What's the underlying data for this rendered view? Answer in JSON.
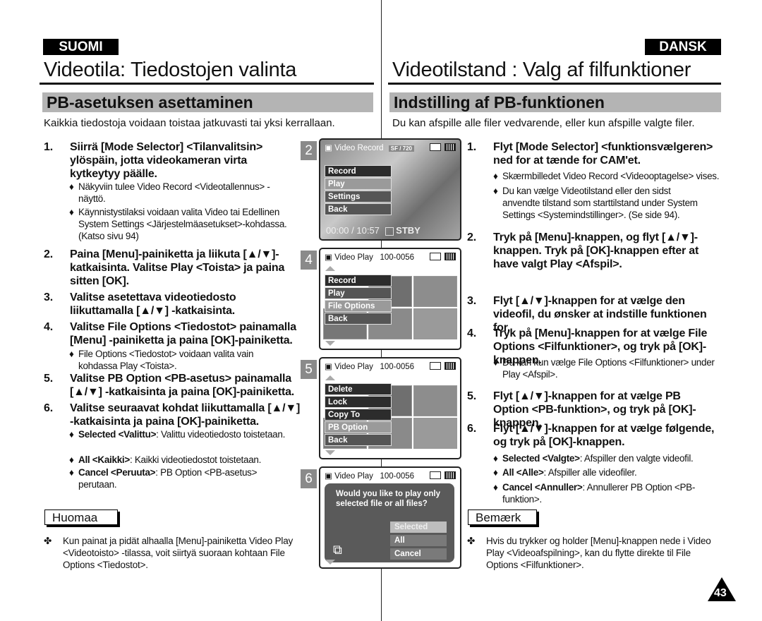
{
  "left": {
    "lang": "SUOMI",
    "title": "Videotila: Tiedostojen valinta",
    "section": "PB-asetuksen asettaminen",
    "intro": "Kaikkia tiedostoja voidaan toistaa jatkuvasti tai yksi kerrallaan.",
    "steps": [
      {
        "num": "1.",
        "text": "Siirrä [Mode Selector] <Tilanvalitsin> ylöspäin, jotta videokameran virta kytkeytyy päälle."
      },
      {
        "num": "2.",
        "text": "Paina [Menu]-painiketta ja liikuta [▲/▼]-katkaisinta. Valitse Play <Toista> ja paina sitten [OK]."
      },
      {
        "num": "3.",
        "text": "Valitse asetettava videotiedosto liikuttamalla [▲/▼] -katkaisinta."
      },
      {
        "num": "4.",
        "text": "Valitse File Options <Tiedostot> painamalla [Menu] -painiketta ja paina [OK]-painiketta."
      },
      {
        "num": "5.",
        "text": "Valitse PB Option <PB-asetus> painamalla [▲/▼] -katkaisinta ja paina [OK]-painiketta."
      },
      {
        "num": "6.",
        "text": "Valitse seuraavat kohdat liikuttamalla [▲/▼] -katkaisinta ja paina [OK]-painiketta."
      }
    ],
    "bullets": {
      "s1a": "Näkyviin tulee Video Record <Videotallennus> -näyttö.",
      "s1b": "Käynnistystilaksi voidaan valita Video tai Edellinen System Settings <Järjestelmäasetukset>-kohdassa. (Katso sivu 94)",
      "s4a": "File Options <Tiedostot> voidaan valita vain kohdassa Play <Toista>.",
      "s6a_label": "Selected <Valittu>",
      "s6a_text": ": Valittu videotiedosto toistetaan.",
      "s6b_label": "All <Kaikki>",
      "s6b_text": ": Kaikki videotiedostot toistetaan.",
      "s6c_label": "Cancel <Peruuta>",
      "s6c_text": ": PB Option <PB-asetus> perutaan."
    },
    "note_title": "Huomaa",
    "note": "Kun painat ja pidät alhaalla [Menu]-painiketta Video Play <Videotoisto> -tilassa, voit siirtyä suoraan kohtaan File Options <Tiedostot>."
  },
  "right": {
    "lang": "DANSK",
    "title": "Videotilstand : Valg af filfunktioner",
    "section": "Indstilling af PB-funktionen",
    "intro": "Du kan afspille alle filer vedvarende, eller kun afspille valgte filer.",
    "steps": [
      {
        "num": "1.",
        "text": "Flyt [Mode Selector] <funktionsvælgeren> ned for at tænde for CAM'et."
      },
      {
        "num": "2.",
        "text": "Tryk på [Menu]-knappen, og flyt [▲/▼]-knappen. Tryk på [OK]-knappen efter at have valgt Play <Afspil>."
      },
      {
        "num": "3.",
        "text": "Flyt [▲/▼]-knappen for at vælge den videofil, du ønsker at indstille funktionen for."
      },
      {
        "num": "4.",
        "text": "Tryk på [Menu]-knappen for at vælge File Options <Filfunktioner>, og tryk på [OK]-knappen."
      },
      {
        "num": "5.",
        "text": "Flyt [▲/▼]-knappen for at vælge PB Option <PB-funktion>, og tryk på [OK]-knappen."
      },
      {
        "num": "6.",
        "text": "Flyt [▲/▼]-knappen for at vælge følgende, og tryk på [OK]-knappen."
      }
    ],
    "bullets": {
      "s1a": "Skærmbilledet Video Record <Videooptagelse> vises.",
      "s1b": "Du kan vælge Videotilstand eller den sidst anvendte tilstand som starttilstand under System Settings <Systemindstillinger>. (Se side 94).",
      "s4a": "Du kan kun vælge File Options <Filfunktioner> under Play <Afspil>.",
      "s6a_label": "Selected <Valgte>",
      "s6a_text": ": Afspiller den valgte videofil.",
      "s6b_label": "All <Alle>",
      "s6b_text": ": Afspiller alle videofiler.",
      "s6c_label": "Cancel <Annuller>",
      "s6c_text": ": Annullerer PB Option <PB-funktion>."
    },
    "note_title": "Bemærk",
    "note": "Hvis du trykker og holder [Menu]-knappen nede i Video Play <Videoafspilning>, kan du flytte direkte til File Options <Filfunktioner>."
  },
  "screens": [
    {
      "num": "2",
      "header": "Video Record",
      "badge": "SF / 720",
      "menu": [
        "Record",
        "Play",
        "Settings",
        "Back"
      ],
      "selected": 1,
      "time": "00:00 / 10:57",
      "status": "STBY"
    },
    {
      "num": "4",
      "header": "Video Play",
      "file": "100-0056",
      "menu": [
        "Record",
        "Play",
        "File Options",
        "Back"
      ],
      "selected": 2
    },
    {
      "num": "5",
      "header": "Video Play",
      "file": "100-0056",
      "menu": [
        "Delete",
        "Lock",
        "Copy To",
        "PB Option",
        "Back"
      ],
      "selected": 3
    },
    {
      "num": "6",
      "header": "Video Play",
      "file": "100-0056",
      "question": "Would you like to play only selected file or all files?",
      "options": [
        "Selected",
        "All",
        "Cancel"
      ],
      "selected": 0
    }
  ],
  "symbols": {
    "diamond": "♦",
    "note_star": "✤",
    "camcorder": "🎥"
  },
  "page_number": "43"
}
